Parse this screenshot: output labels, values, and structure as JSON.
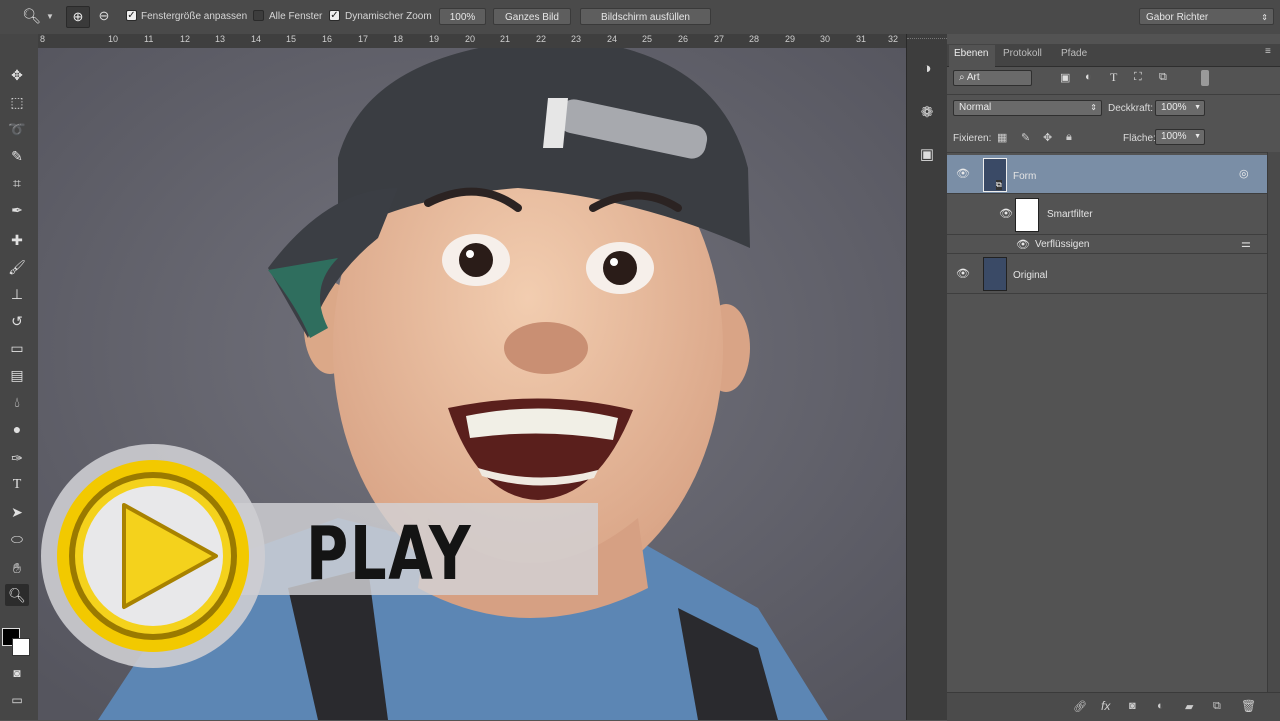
{
  "options_bar": {
    "resize_windows_label": "Fenstergröße anpassen",
    "all_windows_label": "Alle Fenster",
    "dynamic_zoom_label": "Dynamischer Zoom",
    "zoom_100_label": "100%",
    "fit_screen_label": "Ganzes Bild",
    "fill_screen_label": "Bildschirm ausfüllen",
    "workspace_label": "Gabor Richter",
    "checkboxes": {
      "resize_windows": true,
      "all_windows": false,
      "dynamic_zoom": true
    }
  },
  "ruler": {
    "ticks": [
      "8",
      "10",
      "11",
      "12",
      "13",
      "14",
      "15",
      "16",
      "17",
      "18",
      "19",
      "20",
      "21",
      "22",
      "23",
      "24",
      "25",
      "26",
      "27",
      "28",
      "29",
      "30",
      "31",
      "32"
    ]
  },
  "overlay": {
    "play_label": "PLAY",
    "colors": {
      "play_ring": "#f2c900",
      "play_triangle": "#f4d21c"
    }
  },
  "layers_panel": {
    "tabs": [
      "Ebenen",
      "Protokoll",
      "Pfade"
    ],
    "filter_kind": "Art",
    "blend_mode": "Normal",
    "opacity_label": "Deckkraft:",
    "opacity_value": "100%",
    "lock_label": "Fixieren:",
    "fill_label": "Fläche:",
    "fill_value": "100%",
    "layers": [
      {
        "name": "Form",
        "selected": true
      },
      {
        "name": "Smartfilter"
      },
      {
        "name": "Verflüssigen"
      },
      {
        "name": "Original"
      }
    ],
    "selected_color": "#7a8ea6",
    "footer_icons": [
      "link-icon",
      "fx-icon",
      "mask-icon",
      "adjustment-icon",
      "group-icon",
      "new-layer-icon",
      "trash-icon"
    ]
  }
}
